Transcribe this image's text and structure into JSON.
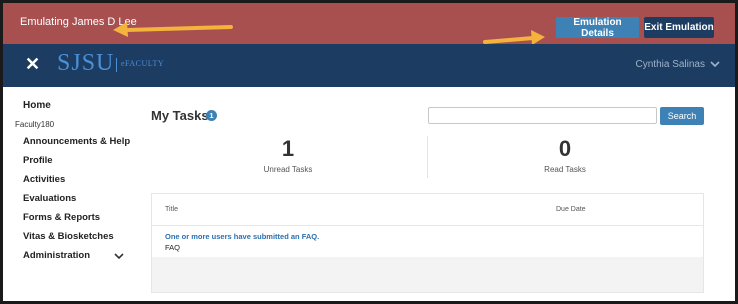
{
  "emulation": {
    "status_text": "Emulating James D Lee",
    "details_label": "Emulation Details",
    "exit_label": "Exit Emulation",
    "arrow_color": "#f3b33d"
  },
  "nav": {
    "close_icon": "close-icon",
    "logo_text": "SJSU",
    "product_text": "eFACULTY",
    "user_name": "Cynthia Salinas"
  },
  "sidebar": {
    "home": "Home",
    "unit": "Faculty180",
    "items": [
      {
        "label": "Announcements & Help"
      },
      {
        "label": "Profile"
      },
      {
        "label": "Activities"
      },
      {
        "label": "Evaluations"
      },
      {
        "label": "Forms & Reports"
      },
      {
        "label": "Vitas & Biosketches"
      },
      {
        "label": "Administration"
      }
    ]
  },
  "main": {
    "title": "My Tasks",
    "badge": "1",
    "search_value": "",
    "search_label": "Search",
    "stats": {
      "unread_count": "1",
      "unread_label": "Unread Tasks",
      "read_count": "0",
      "read_label": "Read Tasks"
    },
    "table": {
      "columns": [
        "Title",
        "Due Date"
      ],
      "rows": [
        {
          "title": "One or more users have submitted an FAQ.",
          "subtitle": "FAQ",
          "due": ""
        }
      ]
    }
  },
  "colors": {
    "emulation_bar": "#a85050",
    "nav_bar": "#1d3c61",
    "accent": "#3e82b5"
  }
}
